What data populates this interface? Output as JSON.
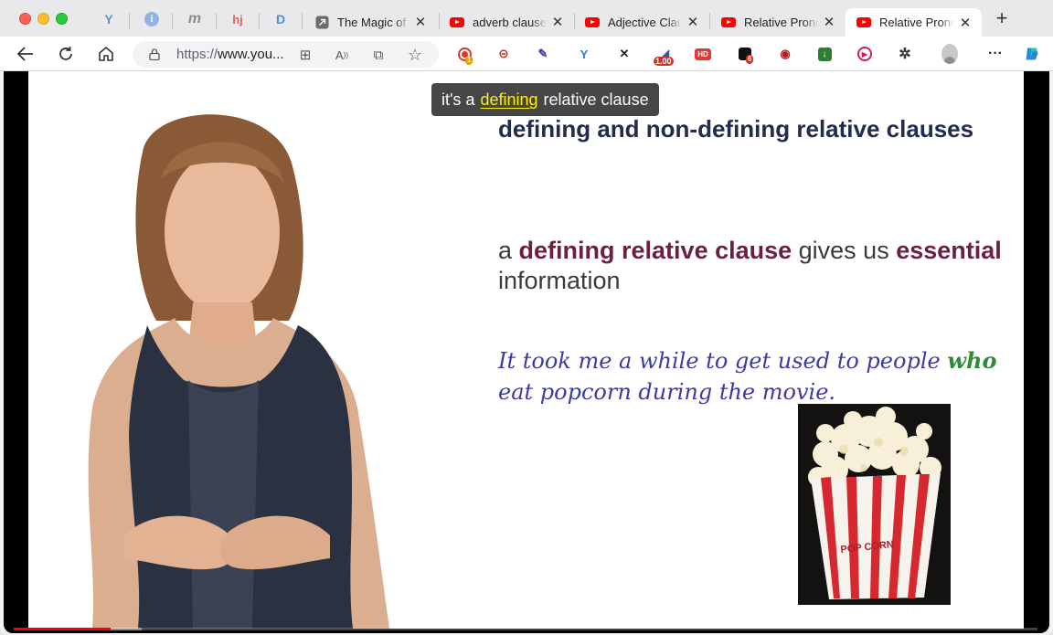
{
  "browser": {
    "tabs": [
      {
        "label": "The Magic of R",
        "icon": "arrow-tab-icon"
      },
      {
        "label": "adverb clause",
        "icon": "youtube-icon"
      },
      {
        "label": "Adjective Clau",
        "icon": "youtube-icon"
      },
      {
        "label": "Relative Prono",
        "icon": "youtube-icon"
      },
      {
        "label": "Relative Prono",
        "icon": "youtube-icon",
        "active": true
      }
    ],
    "pinned_tabs": [
      {
        "glyph": "Y",
        "icon": "vee-icon",
        "color": "#5b8fd8"
      },
      {
        "glyph": "i",
        "icon": "info-icon",
        "color": "#5b8fd8"
      },
      {
        "glyph": "m",
        "icon": "m-icon",
        "color": "#8a8a8a"
      },
      {
        "glyph": "hj",
        "icon": "hj-icon",
        "color": "#e06060"
      },
      {
        "glyph": "D",
        "icon": "d-icon",
        "color": "#4a90e2"
      }
    ],
    "url_prefix": "https://",
    "url_host": "www.you..."
  },
  "extensions": [
    {
      "icon": "record-icon",
      "badge": "1",
      "badge_color": "#e0a000"
    },
    {
      "icon": "search-ext-icon"
    },
    {
      "icon": "notes-ext-icon"
    },
    {
      "icon": "vee-ext-icon"
    },
    {
      "icon": "shuffle-ext-icon"
    },
    {
      "icon": "speed-ext-icon",
      "badge": "1.00",
      "badge_color": "#c0392b"
    },
    {
      "icon": "hd-ext-icon",
      "text": "HD"
    },
    {
      "icon": "box-ext-icon",
      "badge": "6",
      "badge_color": "#d62d20"
    },
    {
      "icon": "video-ext-icon"
    },
    {
      "icon": "download-ext-icon"
    },
    {
      "icon": "play-ext-icon"
    },
    {
      "icon": "puzzle-icon"
    }
  ],
  "video": {
    "caption_prefix": "it's a",
    "caption_highlight": "defining",
    "caption_suffix": "relative clause",
    "slide": {
      "heading": "defining and non-defining relative clauses",
      "definition_parts": [
        {
          "text": "a ",
          "em": false
        },
        {
          "text": "defining relative clause",
          "em": true
        },
        {
          "text": " gives us ",
          "em": false
        },
        {
          "text": "essential",
          "em": true
        },
        {
          "text": " information",
          "em": false
        }
      ],
      "example_before": "It took me a while to get used to people ",
      "example_keyword": "who",
      "example_after": " eat popcorn during the movie.",
      "image_text": "POP CORN"
    },
    "progress_played": 0.095,
    "progress_buffered": 0.125,
    "colors": {
      "emphasis": "#6b1f43",
      "keyword": "#2e8b3a",
      "example": "#3b3ba3",
      "heading": "#232b4e"
    }
  }
}
